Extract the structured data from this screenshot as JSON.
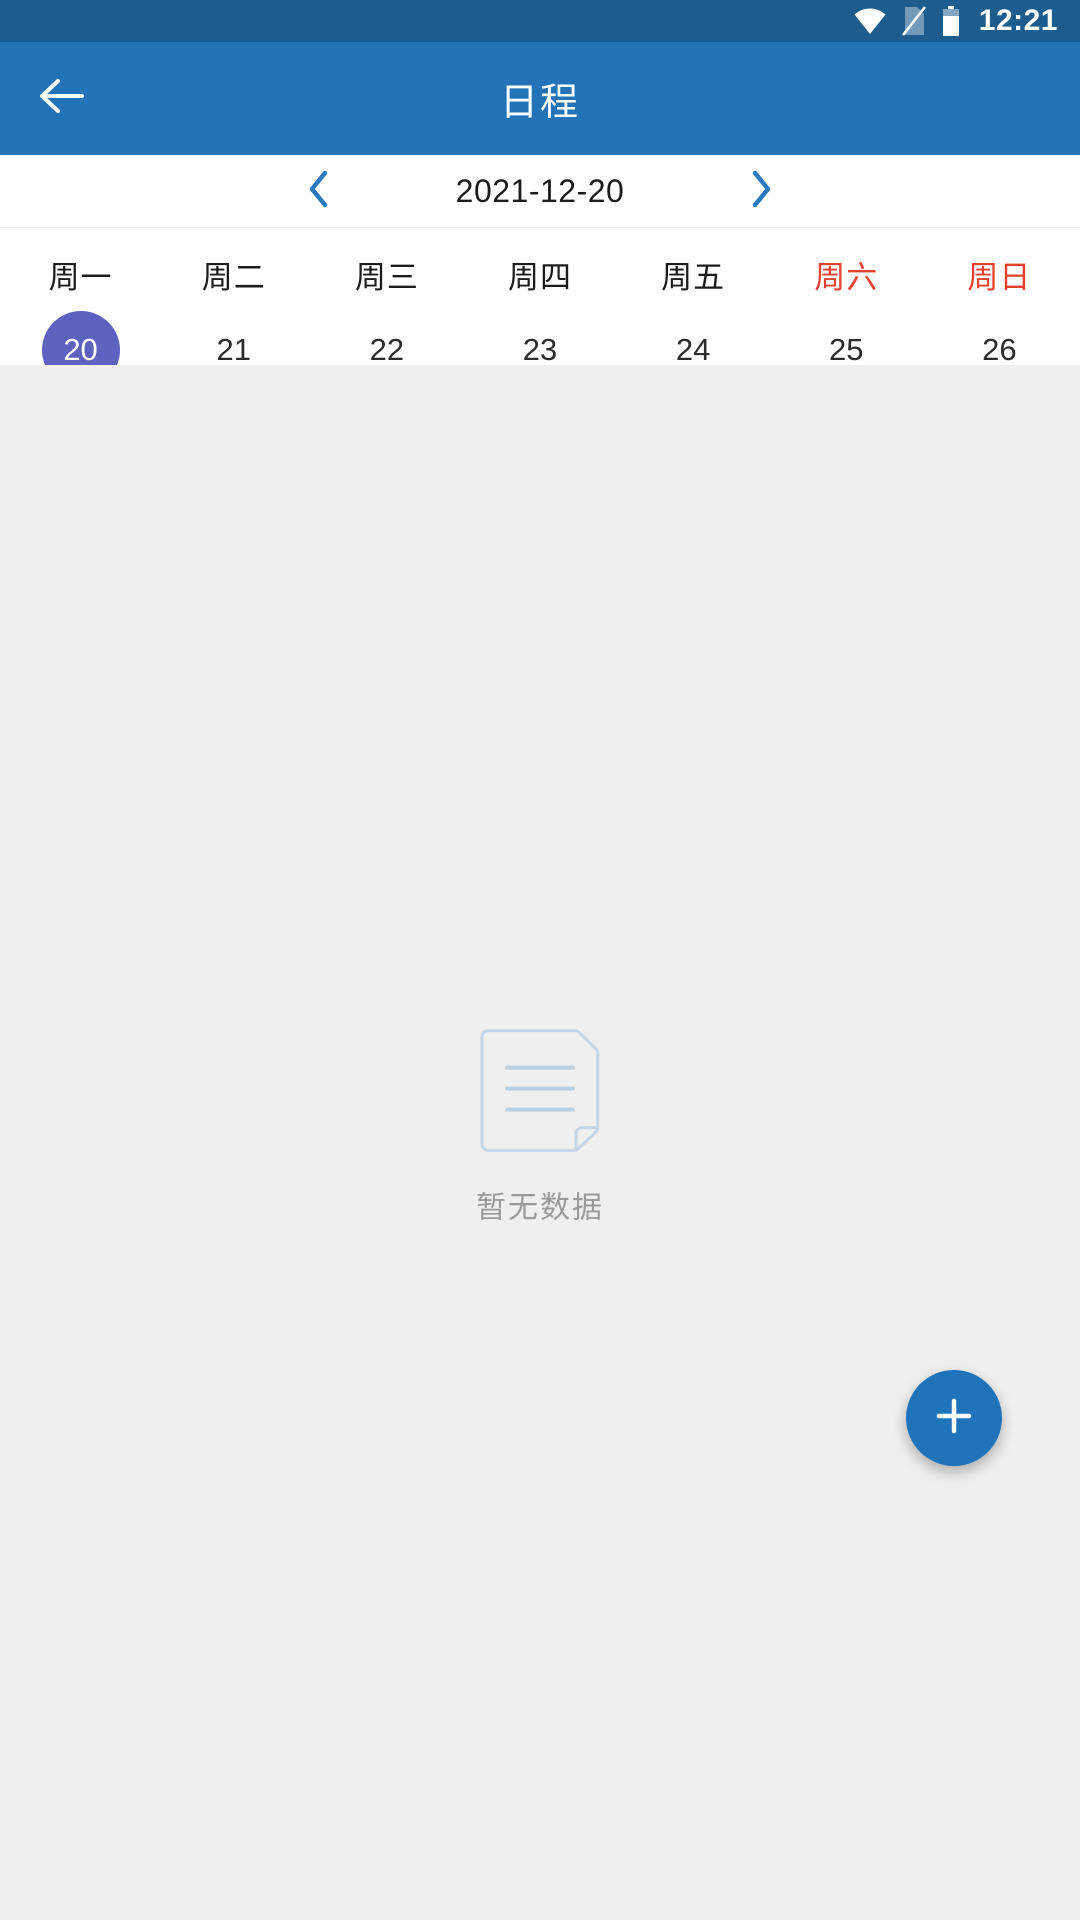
{
  "status_bar": {
    "time": "12:21",
    "icons": [
      "wifi-icon",
      "no-sim-icon",
      "battery-icon"
    ]
  },
  "app_bar": {
    "title": "日程",
    "back_icon": "arrow-left-icon",
    "background_color": "#2273b8"
  },
  "date_nav": {
    "prev_icon": "chevron-left-icon",
    "next_icon": "chevron-right-icon",
    "current_date": "2021-12-20",
    "arrow_color": "#2273b8"
  },
  "week_strip": {
    "selected_index": 0,
    "selected_color": "#5d62c0",
    "weekend_color": "#e8402f",
    "days": [
      {
        "weekday": "周一",
        "number": "20",
        "weekend": false,
        "selected": true
      },
      {
        "weekday": "周二",
        "number": "21",
        "weekend": false,
        "selected": false
      },
      {
        "weekday": "周三",
        "number": "22",
        "weekend": false,
        "selected": false
      },
      {
        "weekday": "周四",
        "number": "23",
        "weekend": false,
        "selected": false
      },
      {
        "weekday": "周五",
        "number": "24",
        "weekend": false,
        "selected": false
      },
      {
        "weekday": "周六",
        "number": "25",
        "weekend": true,
        "selected": false
      },
      {
        "weekday": "周日",
        "number": "26",
        "weekend": true,
        "selected": false
      }
    ]
  },
  "content": {
    "empty_state": {
      "icon": "empty-document-icon",
      "text": "暂无数据",
      "text_color": "#9a9a9a",
      "background_color": "#efeff0"
    }
  },
  "fab": {
    "icon": "plus-icon",
    "label": "+",
    "color": "#1e73bb"
  }
}
